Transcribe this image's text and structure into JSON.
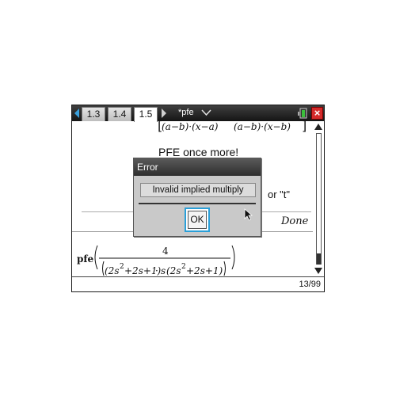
{
  "tabs": [
    {
      "label": "1.3",
      "active": false
    },
    {
      "label": "1.4",
      "active": false
    },
    {
      "label": "1.5",
      "active": true
    }
  ],
  "document": {
    "name": "*pfe"
  },
  "icons": {
    "nav_left": "arrow-left-icon",
    "nav_right": "arrow-right-icon",
    "doc_menu": "chevron-down-icon",
    "battery": "battery-icon",
    "close": "close-icon",
    "cursor": "pointer-cursor-icon"
  },
  "colors": {
    "accent": "#2a9fd8",
    "close": "#d42a2a",
    "battery": "#3bbf3b"
  },
  "content": {
    "top_formula": {
      "left": "(a−b)·(x−a)",
      "right": "(a−b)·(x−b)"
    },
    "pfe_text": "PFE once more!",
    "partial_text": "or \"t\"",
    "done_label": "Done",
    "pfe_expression": {
      "function": "pfe",
      "numerator": "4",
      "denominator_left": "(2s",
      "denominator_left_rest": "+2s+1)",
      "dot": "·",
      "denominator_right_s": "s",
      "denominator_right": "(2s",
      "denominator_right_rest": "+2s+1)",
      "exponent": "2"
    }
  },
  "status": {
    "page": "13/99"
  },
  "dialog": {
    "title": "Error",
    "message": "Invalid implied multiply",
    "ok_label": "OK"
  }
}
